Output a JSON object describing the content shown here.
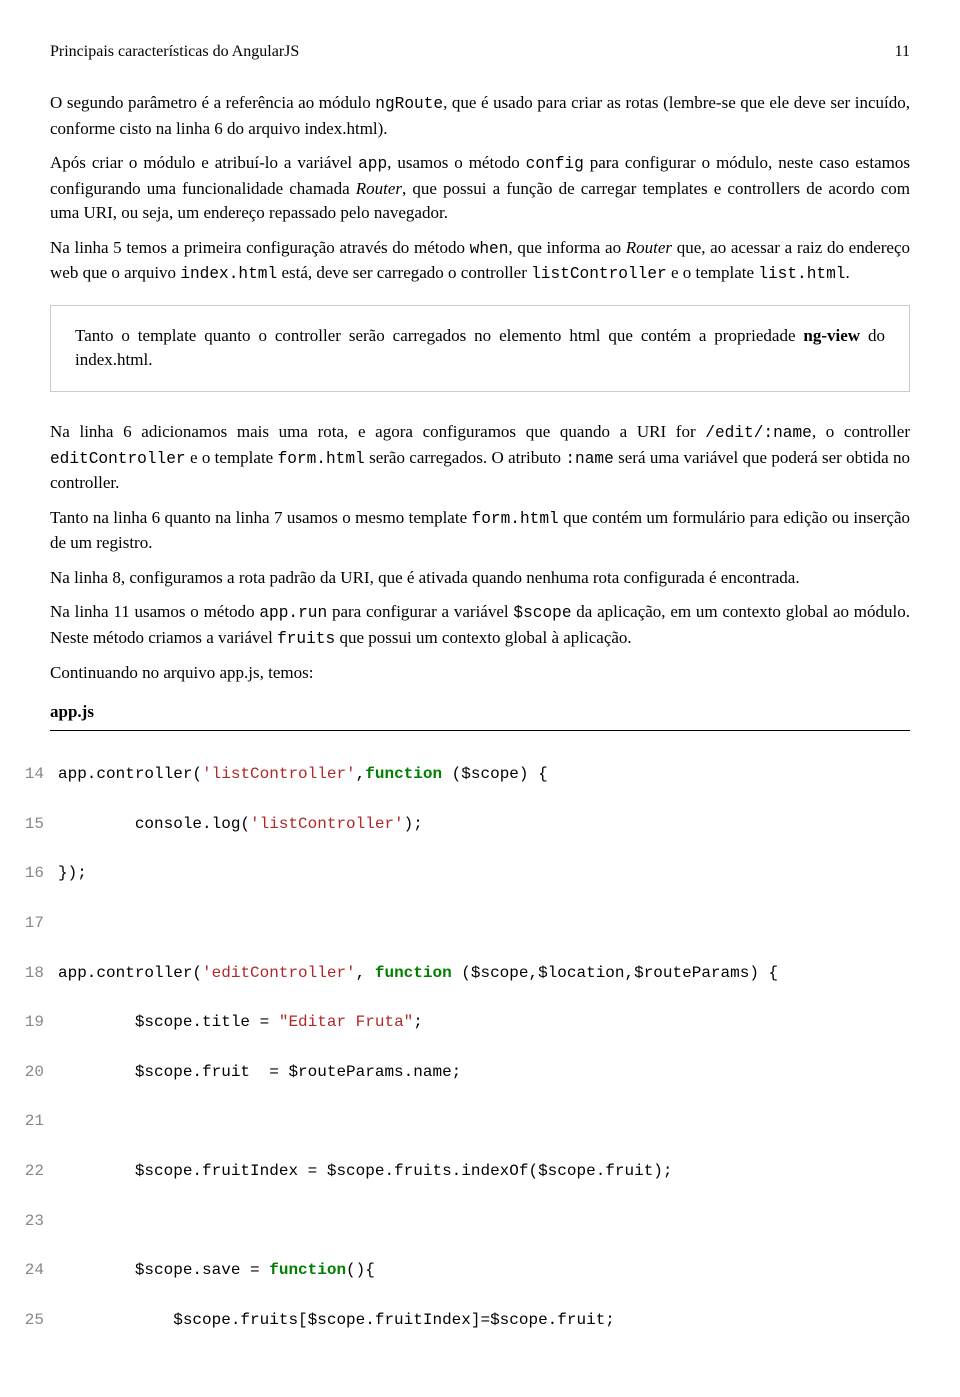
{
  "header": {
    "title": "Principais características do AngularJS",
    "pageno": "11"
  },
  "p1_a": "O segundo parâmetro é a referência ao módulo ",
  "p1_code1": "ngRoute",
  "p1_b": ", que é usado para criar as rotas (lembre-se que ele deve ser incuído, conforme cisto na linha 6 do arquivo index.html).",
  "p2_a": "Após criar o módulo e atribuí-lo a variável ",
  "p2_code1": "app",
  "p2_b": ", usamos o método ",
  "p2_code2": "config",
  "p2_c": " para configurar o módulo, neste caso estamos configurando uma funcionalidade chamada ",
  "p2_i1": "Router",
  "p2_d": ", que possui a função de carregar templates e controllers de acordo com uma URI, ou seja, um endereço repassado pelo navegador.",
  "p3_a": "Na linha 5 temos a primeira configuração através do método ",
  "p3_code1": "when",
  "p3_b": ", que informa ao ",
  "p3_i1": "Router",
  "p3_c": " que, ao acessar a raiz do endereço web que o arquivo ",
  "p3_code2": "index.html",
  "p3_d": " está, deve ser carregado o controller ",
  "p3_code3": "listController",
  "p3_e": " e o template ",
  "p3_code4": "list.html",
  "p3_f": ".",
  "note_a": "Tanto o template quanto o controller serão carregados no elemento html que contém a propriedade ",
  "note_b": "ng-view",
  "note_c": " do index.html.",
  "p4_a": "Na linha 6 adicionamos mais uma rota, e agora configuramos que quando a URI for ",
  "p4_code1": "/edit/:name",
  "p4_b": ", o controller ",
  "p4_code2": "editController",
  "p4_c": " e o template ",
  "p4_code3": "form.html",
  "p4_d": " serão carregados. O atributo ",
  "p4_code4": ":name",
  "p4_e": " será uma variável que poderá ser obtida no controller.",
  "p5_a": "Tanto na linha 6 quanto na linha 7 usamos o mesmo template ",
  "p5_code1": "form.html",
  "p5_b": " que contém um formulário para edição ou inserção de um registro.",
  "p6": "Na linha 8, configuramos a rota padrão da URI, que é ativada quando nenhuma rota configurada é encontrada.",
  "p7_a": "Na linha 11 usamos o método ",
  "p7_code1": "app.run",
  "p7_b": " para configurar a variável ",
  "p7_code2": "$scope",
  "p7_c": " da aplicação, em um contexto global ao módulo. Neste método criamos a variável ",
  "p7_code3": "fruits",
  "p7_d": " que possui um contexto global à aplicação.",
  "p8": "Continuando no arquivo app.js, temos:",
  "code_filename": "app.js",
  "code": {
    "l14": {
      "n": "14",
      "a": "app.controller(",
      "s1": "'listController'",
      "b": ",",
      "kw": "function",
      "c": " ($scope) {"
    },
    "l15": {
      "n": "15",
      "a": "        console.log(",
      "s1": "'listController'",
      "b": ");"
    },
    "l16": {
      "n": "16",
      "a": "});"
    },
    "l17": {
      "n": "17",
      "a": ""
    },
    "l18": {
      "n": "18",
      "a": "app.controller(",
      "s1": "'editController'",
      "b": ", ",
      "kw": "function",
      "c": " ($scope,$location,$routeParams) {"
    },
    "l19": {
      "n": "19",
      "a": "        $scope.title = ",
      "s1": "\"Editar Fruta\"",
      "b": ";"
    },
    "l20": {
      "n": "20",
      "a": "        $scope.fruit  = $routeParams.name;"
    },
    "l21": {
      "n": "21",
      "a": ""
    },
    "l22": {
      "n": "22",
      "a": "        $scope.fruitIndex = $scope.fruits.indexOf($scope.fruit);"
    },
    "l23": {
      "n": "23",
      "a": ""
    },
    "l24": {
      "n": "24",
      "a": "        $scope.save = ",
      "kw": "function",
      "b": "(){"
    },
    "l25": {
      "n": "25",
      "a": "            $scope.fruits[$scope.fruitIndex]=$scope.fruit;"
    }
  }
}
